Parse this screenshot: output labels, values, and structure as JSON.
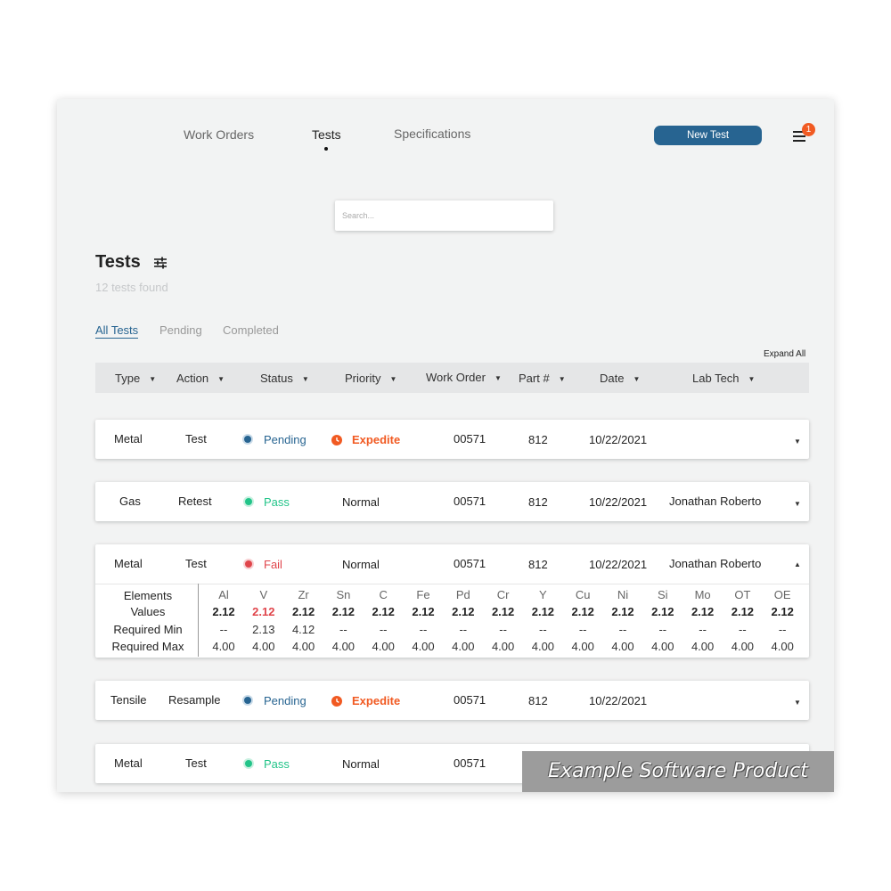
{
  "nav": {
    "links": [
      "Work Orders",
      "Tests",
      "Specifications"
    ],
    "new_test_label": "New Test",
    "notification_count": "1"
  },
  "search": {
    "placeholder": "Search..."
  },
  "page": {
    "title": "Tests",
    "count": "12 tests found"
  },
  "tabs": [
    "All Tests",
    "Pending",
    "Completed"
  ],
  "expand_all": "Expand All",
  "columns": [
    "Type",
    "Action",
    "Status",
    "Priority",
    "Work Order",
    "Part #",
    "Date",
    "Lab Tech"
  ],
  "colors": {
    "primary": "#276491",
    "pending": "#276491",
    "pass": "#22c489",
    "fail": "#e0454b",
    "expedite": "#f15a22"
  },
  "rows": [
    {
      "type": "Metal",
      "action": "Test",
      "status": "Pending",
      "priority": "Expedite",
      "work_order": "00571",
      "part": "812",
      "date": "10/22/2021",
      "tech": ""
    },
    {
      "type": "Gas",
      "action": "Retest",
      "status": "Pass",
      "priority": "Normal",
      "work_order": "00571",
      "part": "812",
      "date": "10/22/2021",
      "tech": "Jonathan Roberto"
    },
    {
      "type": "Metal",
      "action": "Test",
      "status": "Fail",
      "priority": "Normal",
      "work_order": "00571",
      "part": "812",
      "date": "10/22/2021",
      "tech": "Jonathan Roberto",
      "details": {
        "labels": [
          "Elements",
          "Values",
          "Required Min",
          "Required Max"
        ],
        "elements": [
          {
            "name": "Al",
            "value": "2.12",
            "min": "--",
            "max": "4.00"
          },
          {
            "name": "V",
            "value": "2.12",
            "min": "2.13",
            "max": "4.00",
            "fail": true
          },
          {
            "name": "Zr",
            "value": "2.12",
            "min": "4.12",
            "max": "4.00"
          },
          {
            "name": "Sn",
            "value": "2.12",
            "min": "--",
            "max": "4.00"
          },
          {
            "name": "C",
            "value": "2.12",
            "min": "--",
            "max": "4.00"
          },
          {
            "name": "Fe",
            "value": "2.12",
            "min": "--",
            "max": "4.00"
          },
          {
            "name": "Pd",
            "value": "2.12",
            "min": "--",
            "max": "4.00"
          },
          {
            "name": "Cr",
            "value": "2.12",
            "min": "--",
            "max": "4.00"
          },
          {
            "name": "Y",
            "value": "2.12",
            "min": "--",
            "max": "4.00"
          },
          {
            "name": "Cu",
            "value": "2.12",
            "min": "--",
            "max": "4.00"
          },
          {
            "name": "Ni",
            "value": "2.12",
            "min": "--",
            "max": "4.00"
          },
          {
            "name": "Si",
            "value": "2.12",
            "min": "--",
            "max": "4.00"
          },
          {
            "name": "Mo",
            "value": "2.12",
            "min": "--",
            "max": "4.00"
          },
          {
            "name": "OT",
            "value": "2.12",
            "min": "--",
            "max": "4.00"
          },
          {
            "name": "OE",
            "value": "2.12",
            "min": "--",
            "max": "4.00"
          }
        ]
      }
    },
    {
      "type": "Tensile",
      "action": "Resample",
      "status": "Pending",
      "priority": "Expedite",
      "work_order": "00571",
      "part": "812",
      "date": "10/22/2021",
      "tech": ""
    },
    {
      "type": "Metal",
      "action": "Test",
      "status": "Pass",
      "priority": "Normal",
      "work_order": "00571",
      "part": "",
      "date": "",
      "tech": ""
    }
  ],
  "watermark": "Example Software Product"
}
